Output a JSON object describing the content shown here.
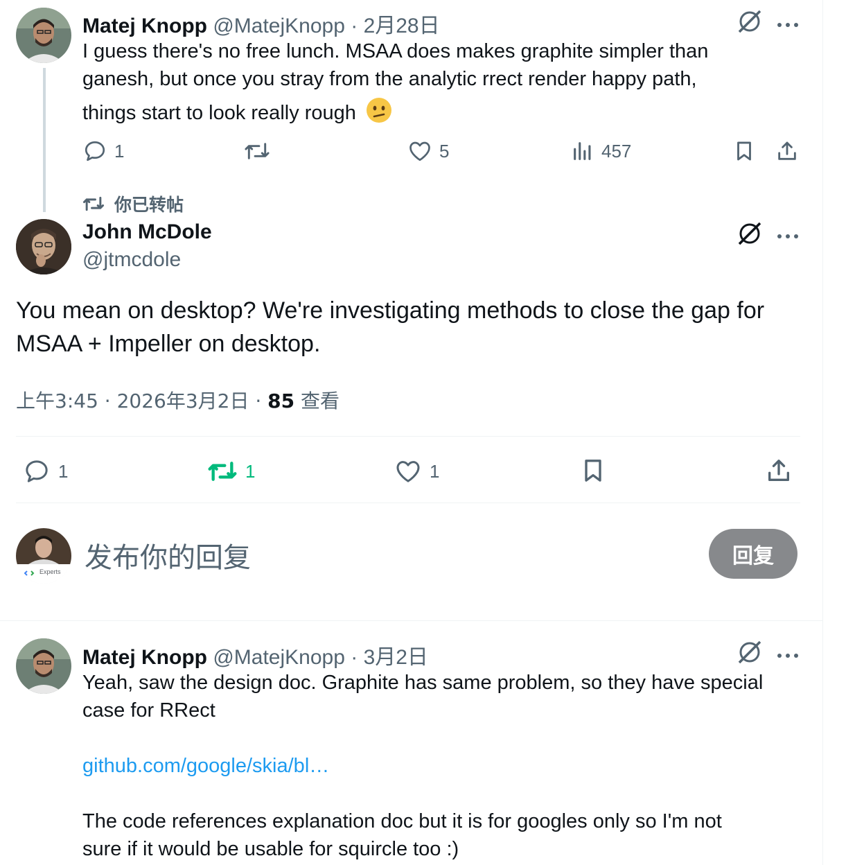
{
  "tweet1": {
    "name": "Matej Knopp",
    "meta": "@MatejKnopp · 2月28日",
    "lines": [
      "I guess there's no free lunch. MSAA does makes graphite simpler than",
      "ganesh, but once you stray from the analytic rrect render happy path,",
      "things start to look really rough"
    ],
    "emoji": "confused-face-emoji",
    "stats": {
      "replies": "1",
      "likes": "5",
      "views": "457"
    }
  },
  "retweet_note": "你已转帖",
  "main_tweet": {
    "name": "John McDole",
    "handle": "@jtmcdole",
    "lines": [
      "You mean on desktop? We're investigating methods to close the gap for",
      "MSAA + Impeller on desktop."
    ],
    "time": "上午3:45 · 2026年3月2日 · ",
    "views_count": "85",
    "views_label": "查看",
    "stats": {
      "replies": "1",
      "retweets": "1",
      "likes": "1"
    },
    "retweet_color": "#00ba7c"
  },
  "compose": {
    "placeholder": "发布你的回复",
    "button": "回复",
    "avatar_text": "Experts"
  },
  "tweet2": {
    "name": "Matej Knopp",
    "meta": "@MatejKnopp · 3月2日",
    "lines": [
      "Yeah, saw the design doc. Graphite has same problem, so they have special",
      "case for RRect"
    ],
    "link": "github.com/google/skia/bl…",
    "lines2": [
      "The code references explanation doc but it is for googles only so I'm not",
      "sure if it would be usable for squircle too :)"
    ]
  },
  "colors": {
    "link": "#1d9bf0",
    "muted": "#536471",
    "retweet_green": "#00ba7c"
  }
}
